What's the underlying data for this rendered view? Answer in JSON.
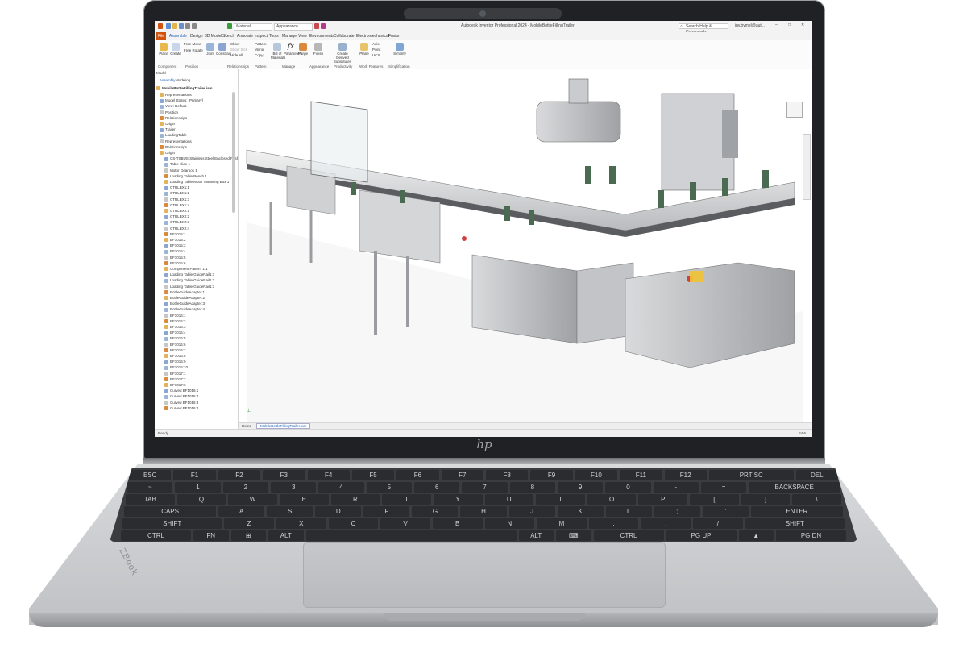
{
  "window": {
    "title": "Autodesk Inventor Professional 2024 - MobileBottleFillingTrailer",
    "search_placeholder": "Search Help & Commands...",
    "user": "inv.bymel@aut...",
    "material": "Material",
    "appearance": "Appearance"
  },
  "tabs": [
    "File",
    "Assemble",
    "Design",
    "3D Model",
    "Sketch",
    "Annotate",
    "Inspect",
    "Tools",
    "Manage",
    "View",
    "Environments",
    "Collaborate",
    "Electromechanical",
    "Fusion"
  ],
  "ribbon": {
    "buttons": [
      "Place",
      "Create",
      "Free Move",
      "Free Rotate",
      "Joint",
      "Constrain",
      "Show",
      "Show Sick",
      "Hide All",
      "Pattern",
      "Mirror",
      "Copy",
      "Bill of Materials",
      "Parameters",
      "Purge",
      "Finish",
      "Create Derived Substitutes",
      "Plane",
      "Axis",
      "Point",
      "UCS",
      "Simplify"
    ],
    "groups": [
      "Component",
      "Position",
      "Relationships",
      "Pattern",
      "Manage",
      "Appearance",
      "Productivity",
      "Work Features",
      "Simplification"
    ]
  },
  "browser": {
    "tabs": [
      "Model",
      "Assembly",
      "Modeling"
    ],
    "root": "MobileBottleFillingTrailer.iam",
    "items": [
      "Representations",
      "Model States: [Primary]",
      "View: Default",
      "Position",
      "Relationships",
      "Origin",
      "Trailer",
      "LoadingTable",
      "Representations",
      "Relationships",
      "Origin",
      "CS-TSBUS-Stainless Steel Enclosed Push Button Sw",
      "Table slide 1",
      "Motor Gearbox 1",
      "Loading Table Bench 1",
      "Loading Table Motor Mounting Box 1",
      "CTRLBX1:1",
      "CTRLBX1:2",
      "CTRLBX1:3",
      "CTRLBX1:4",
      "CTRLBX2:1",
      "CTRLBX2:2",
      "CTRLBX2:3",
      "CTRLBX2:4",
      "BF1015:1",
      "BF1015:2",
      "BF1015:3",
      "BF1015:4",
      "BF1015:5",
      "BF1015:6",
      "Component Pattern 1:1",
      "Loading Table GuideRail1:1",
      "Loading Table GuideRail1:2",
      "Loading Table GuideRail1:3",
      "BottleGuideAdapter:1",
      "BottleGuideAdapter:2",
      "BottleGuideAdapter:3",
      "BottleGuideAdapter:4",
      "BF1016:1",
      "BF1016:2",
      "BF1016:3",
      "BF1016:4",
      "BF1016:5",
      "BF1016:6",
      "BF1016:7",
      "BF1016:8",
      "BF1016:9",
      "BF1016:10",
      "BF1017:1",
      "BF1017:2",
      "BF1017:3",
      "Curved BF1016:1",
      "Curved BF1016:2",
      "Curved BF1016:3",
      "Curved BF1016:4"
    ]
  },
  "doc_tabs": [
    "Home",
    "MobileBottleFillingTrailer.iam"
  ],
  "status": {
    "left": "Ready",
    "right": "24 6"
  },
  "laptop": {
    "brand": "ZBook",
    "logo": "hp"
  },
  "keyboard": {
    "rows": [
      [
        "ESC",
        "F1",
        "F2",
        "F3",
        "F4",
        "F5",
        "F6",
        "F7",
        "F8",
        "F9",
        "F10",
        "F11",
        "F12",
        "PRT SC",
        "DEL"
      ],
      [
        "~",
        "1",
        "2",
        "3",
        "4",
        "5",
        "6",
        "7",
        "8",
        "9",
        "0",
        "-",
        "=",
        "BACKSPACE"
      ],
      [
        "TAB",
        "Q",
        "W",
        "E",
        "R",
        "T",
        "Y",
        "U",
        "I",
        "O",
        "P",
        "[",
        "]",
        "\\"
      ],
      [
        "CAPS",
        "A",
        "S",
        "D",
        "F",
        "G",
        "H",
        "J",
        "K",
        "L",
        ";",
        "'",
        "ENTER"
      ],
      [
        "SHIFT",
        "Z",
        "X",
        "C",
        "V",
        "B",
        "N",
        "M",
        ",",
        ".",
        "/",
        "SHIFT"
      ],
      [
        "CTRL",
        "FN",
        "⊞",
        "ALT",
        "",
        "ALT",
        "⌨",
        "CTRL",
        "PG UP",
        "▲",
        "PG DN"
      ]
    ]
  },
  "colors": {
    "file_tab": "#d1540e",
    "ribbon_bg": "#fbfbfb",
    "chassis": "#c9cbce"
  }
}
